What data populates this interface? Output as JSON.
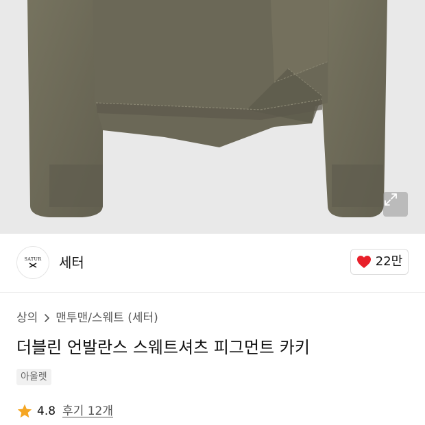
{
  "product_image": {
    "alt": "",
    "colors": {
      "background": "#e9e9e9",
      "garment": "#6f6c5f",
      "garment_shadow": "#5f5c50"
    }
  },
  "expand_button": {
    "icon": "expand-icon"
  },
  "brand": {
    "logo_text": "SATUR",
    "name": "세터"
  },
  "like": {
    "icon": "heart-icon",
    "count": "22만",
    "color": "#e8202a"
  },
  "breadcrumb": {
    "items": [
      "상의",
      "맨투맨/스웨트 (세터)"
    ],
    "separator_icon": "chevron-right-icon"
  },
  "product": {
    "title": "더블린 언발란스 스웨트셔츠 피그먼트 카키",
    "tag": "아울렛"
  },
  "rating": {
    "icon": "star-icon",
    "star_color": "#f5a623",
    "value": "4.8",
    "review_label": "후기 12개"
  }
}
